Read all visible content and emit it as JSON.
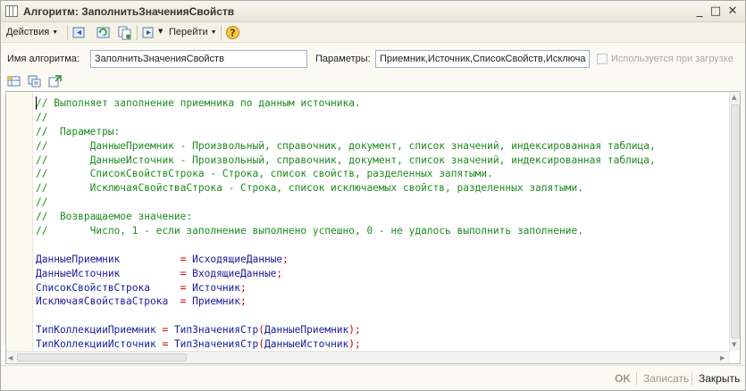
{
  "window": {
    "title": "Алгоритм: ЗаполнитьЗначенияСвойств",
    "controls": {
      "minimize": "_",
      "maximize": "□",
      "close": "✕"
    }
  },
  "toolbar": {
    "actions_label": "Действия",
    "goto_label": "Перейти",
    "icons": [
      "back-arrow-icon",
      "refresh-icon",
      "copy-icon",
      "goto-icon",
      "help-icon"
    ]
  },
  "params": {
    "name_label": "Имя алгоритма:",
    "name_value": "ЗаполнитьЗначенияСвойств",
    "params_label": "Параметры:",
    "params_value": "Приемник,Источник,СписокСвойств,Исключа",
    "on_load_label": "Используется при загрузке"
  },
  "code": {
    "lines": [
      [
        {
          "t": "// Выполняет заполнение приемника по данным источника.",
          "c": "cm"
        }
      ],
      [
        {
          "t": "//",
          "c": "cm"
        }
      ],
      [
        {
          "t": "//  Параметры:",
          "c": "cm"
        }
      ],
      [
        {
          "t": "//       ДанныеПриемник - Произвольный, справочник, документ, список значений, индексированная таблица,",
          "c": "cm"
        }
      ],
      [
        {
          "t": "//       ДанныеИсточник - Произвольный, справочник, документ, список значений, индексированная таблица,",
          "c": "cm"
        }
      ],
      [
        {
          "t": "//       СписокСвойствСтрока - Строка, список свойств, разделенных запятыми.",
          "c": "cm"
        }
      ],
      [
        {
          "t": "//       ИсключаяСвойстваСтрока - Строка, список исключаемых свойств, разделенных запятыми.",
          "c": "cm"
        }
      ],
      [
        {
          "t": "//",
          "c": "cm"
        }
      ],
      [
        {
          "t": "//  Возвращаемое значение:",
          "c": "cm"
        }
      ],
      [
        {
          "t": "//       Число, 1 - если заполнение выполнено успешно, 0 - не удалось выполнить заполнение.",
          "c": "cm"
        }
      ],
      [],
      [
        {
          "t": "ДанныеПриемник",
          "c": "id"
        },
        {
          "t": "          = ",
          "c": "op"
        },
        {
          "t": "ИсходящиеДанные",
          "c": "id"
        },
        {
          "t": ";",
          "c": "pn"
        }
      ],
      [
        {
          "t": "ДанныеИсточник",
          "c": "id"
        },
        {
          "t": "          = ",
          "c": "op"
        },
        {
          "t": "ВходящиеДанные",
          "c": "id"
        },
        {
          "t": ";",
          "c": "pn"
        }
      ],
      [
        {
          "t": "СписокСвойствСтрока",
          "c": "id"
        },
        {
          "t": "     = ",
          "c": "op"
        },
        {
          "t": "Источник",
          "c": "id"
        },
        {
          "t": ";",
          "c": "pn"
        }
      ],
      [
        {
          "t": "ИсключаяСвойстваСтрока",
          "c": "id"
        },
        {
          "t": "  = ",
          "c": "op"
        },
        {
          "t": "Приемник",
          "c": "id"
        },
        {
          "t": ";",
          "c": "pn"
        }
      ],
      [],
      [
        {
          "t": "ТипКоллекцииПриемник",
          "c": "id"
        },
        {
          "t": " = ",
          "c": "op"
        },
        {
          "t": "ТипЗначенияСтр",
          "c": "id"
        },
        {
          "t": "(",
          "c": "pn"
        },
        {
          "t": "ДанныеПриемник",
          "c": "id"
        },
        {
          "t": ");",
          "c": "pn"
        }
      ],
      [
        {
          "t": "ТипКоллекцииИсточник",
          "c": "id"
        },
        {
          "t": " = ",
          "c": "op"
        },
        {
          "t": "ТипЗначенияСтр",
          "c": "id"
        },
        {
          "t": "(",
          "c": "pn"
        },
        {
          "t": "ДанныеИсточник",
          "c": "id"
        },
        {
          "t": ");",
          "c": "pn"
        }
      ]
    ]
  },
  "footer": {
    "ok_label": "OK",
    "save_label": "Записать",
    "close_label": "Закрыть"
  }
}
